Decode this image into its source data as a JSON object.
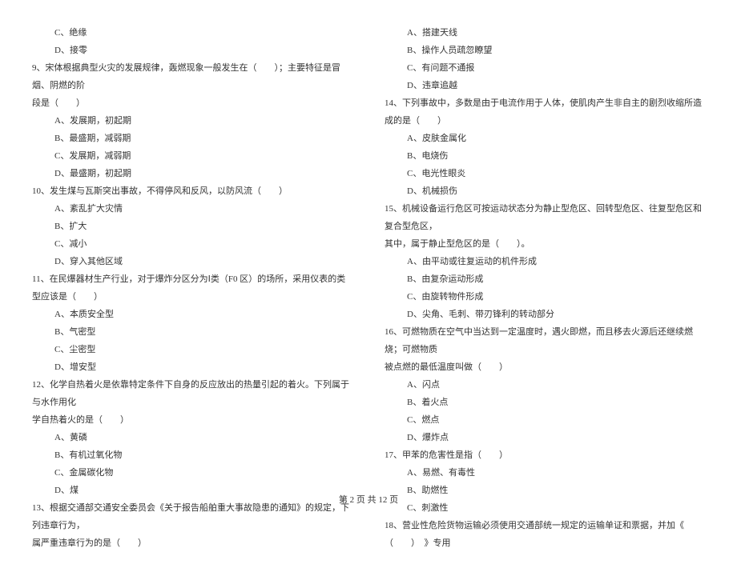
{
  "left": {
    "optC1": "C、绝缘",
    "optD1": "D、接零",
    "q9": "9、宋体根据典型火灾的发展规律，轰燃现象一般发生在（　　）；主要特征是冒烟、阴燃的阶",
    "q9b": "段是（　　）",
    "q9A": "A、发展期，初起期",
    "q9B": "B、最盛期，减弱期",
    "q9C": "C、发展期，减弱期",
    "q9D": "D、最盛期，初起期",
    "q10": "10、发生煤与瓦斯突出事故，不得停风和反风，以防风流（　　）",
    "q10A": "A、紊乱扩大灾情",
    "q10B": "B、扩大",
    "q10C": "C、减小",
    "q10D": "D、穿入其他区域",
    "q11": "11、在民爆器材生产行业，对于爆炸分区分为Ⅰ类（F0 区）的场所，采用仪表的类型应该是（　　）",
    "q11A": "A、本质安全型",
    "q11B": "B、气密型",
    "q11C": "C、尘密型",
    "q11D": "D、增安型",
    "q12": "12、化学自热着火是依靠特定条件下自身的反应放出的热量引起的着火。下列属于与水作用化",
    "q12b": "学自热着火的是（　　）",
    "q12A": "A、黄磷",
    "q12B": "B、有机过氧化物",
    "q12C": "C、金属碳化物",
    "q12D": "D、煤",
    "q13": "13、根据交通部交通安全委员会《关于报告船舶重大事故隐患的通知》的规定，下列违章行为，",
    "q13b": "属严重违章行为的是（　　）"
  },
  "right": {
    "optA2": "A、搭建天线",
    "optB2": "B、操作人员疏忽瞭望",
    "optC2": "C、有问题不通报",
    "optD2": "D、违章追越",
    "q14": "14、下列事故中，多数是由于电流作用于人体，使肌肉产生非自主的剧烈收缩所造成的是（　　）",
    "q14A": "A、皮肤金属化",
    "q14B": "B、电烧伤",
    "q14C": "C、电光性眼炎",
    "q14D": "D、机械损伤",
    "q15": "15、机械设备运行危区可按运动状态分为静止型危区、回转型危区、往复型危区和复合型危区，",
    "q15b": "其中，属于静止型危区的是（　　）。",
    "q15A": "A、由平动或往复运动的机件形成",
    "q15B": "B、由复杂运动形成",
    "q15C": "C、由旋转物件形成",
    "q15D": "D、尖角、毛刺、带刃锋利的转动部分",
    "q16": "16、可燃物质在空气中当达到一定温度时，遇火即燃，而且移去火源后还继续燃烧；可燃物质",
    "q16b": "被点燃的最低温度叫做（　　）",
    "q16A": "A、闪点",
    "q16B": "B、着火点",
    "q16C": "C、燃点",
    "q16D": "D、爆炸点",
    "q17": "17、甲苯的危害性是指（　　）",
    "q17A": "A、易燃、有毒性",
    "q17B": "B、助燃性",
    "q17C": "C、刺激性",
    "q18": "18、营业性危险货物运输必须使用交通部统一规定的运输单证和票据，并加《　（　　）　》专用"
  },
  "footer": "第 2 页 共 12 页"
}
